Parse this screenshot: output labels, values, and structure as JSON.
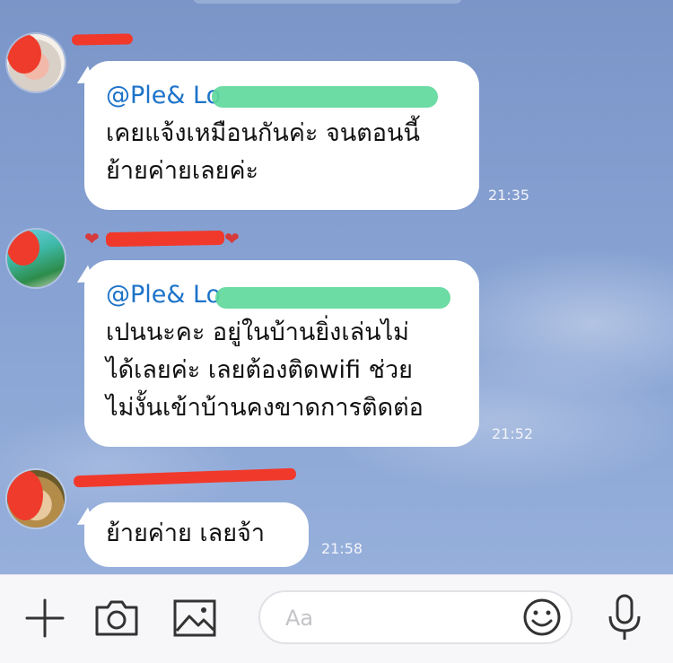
{
  "messages": [
    {
      "sender": "",
      "mention": "@Ple& Lo",
      "text": "เคยแจ้งเหมือนกันค่ะ จนตอนนี้\nย้ายค่ายเลยค่ะ",
      "time": "21:35"
    },
    {
      "sender": "",
      "mention": "@Ple& Lo",
      "text": "เปนนะคะ อยู่ในบ้านยิ่งเล่นไม่\nได้เลยค่ะ เลยต้องติดwifi ช่วย\nไม่งั้นเข้าบ้านคงขาดการติดต่อ",
      "time": "21:52"
    },
    {
      "sender": "",
      "mention": "",
      "text": "ย้ายค่าย เลยจ้า",
      "time": "21:58"
    }
  ],
  "input": {
    "placeholder": "Aa",
    "value": ""
  },
  "icons": {
    "add": "plus-icon",
    "camera": "camera-icon",
    "gallery": "image-icon",
    "emoji": "emoji-icon",
    "voice": "microphone-icon"
  },
  "colors": {
    "mention": "#1d73c9",
    "bubble": "#ffffff",
    "redaction_red": "#f0392b",
    "redaction_green": "#5fd89c",
    "background": "#86a1d2"
  }
}
